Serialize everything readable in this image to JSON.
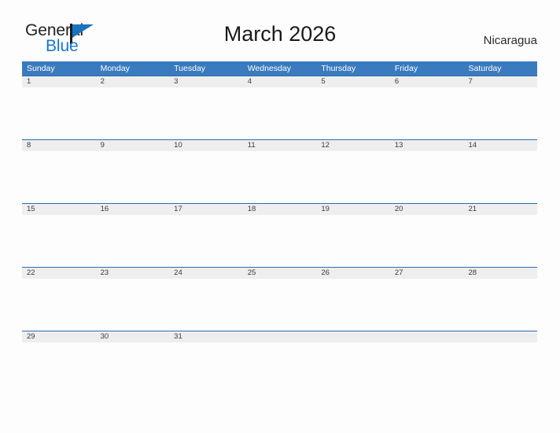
{
  "brand": {
    "name_part1": "General",
    "name_part2": "Blue",
    "flag_icon": "flag-icon"
  },
  "header": {
    "title": "March 2026",
    "locale": "Nicaragua"
  },
  "calendar": {
    "month": "March",
    "year": "2026",
    "weekday_headers": [
      "Sunday",
      "Monday",
      "Tuesday",
      "Wednesday",
      "Thursday",
      "Friday",
      "Saturday"
    ],
    "weeks": [
      [
        "1",
        "2",
        "3",
        "4",
        "5",
        "6",
        "7"
      ],
      [
        "8",
        "9",
        "10",
        "11",
        "12",
        "13",
        "14"
      ],
      [
        "15",
        "16",
        "17",
        "18",
        "19",
        "20",
        "21"
      ],
      [
        "22",
        "23",
        "24",
        "25",
        "26",
        "27",
        "28"
      ],
      [
        "29",
        "30",
        "31",
        "",
        "",
        "",
        ""
      ]
    ]
  },
  "colors": {
    "header_blue": "#3a7bbf",
    "row_divider_blue": "#2d6ca8",
    "date_band_gray": "#eeeeee",
    "brand_blue": "#1878cf",
    "flag_blue": "#1c73bd",
    "page_background": "#fdfdfd"
  }
}
